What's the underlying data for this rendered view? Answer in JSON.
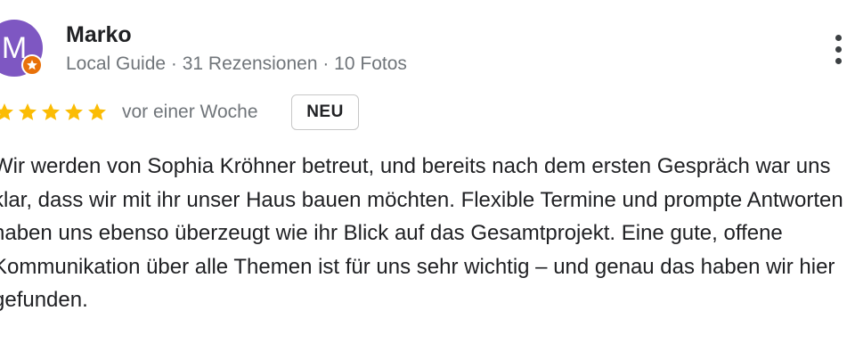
{
  "review": {
    "author": {
      "initial": "M",
      "name": "Marko",
      "meta": "Local Guide · 31 Rezensionen · 10 Fotos",
      "avatar_color": "#7e57c2",
      "badge_color": "#e8710a"
    },
    "rating": {
      "stars": 5,
      "max": 5,
      "star_color": "#fbbc04"
    },
    "date": "vor einer Woche",
    "badge": "NEU",
    "text": "Wir werden von Sophia Kröhner betreut, und bereits nach dem ersten Gespräch war uns klar, dass wir mit ihr unser Haus bauen möchten. Flexible Termine und prompte Antworten haben uns ebenso überzeugt wie ihr Blick auf das Gesamtprojekt. Eine gute, offene Kommunikation über alle Themen ist für uns sehr wichtig – und genau das haben wir hier gefunden.",
    "menu_icon": "more-vert-icon"
  }
}
